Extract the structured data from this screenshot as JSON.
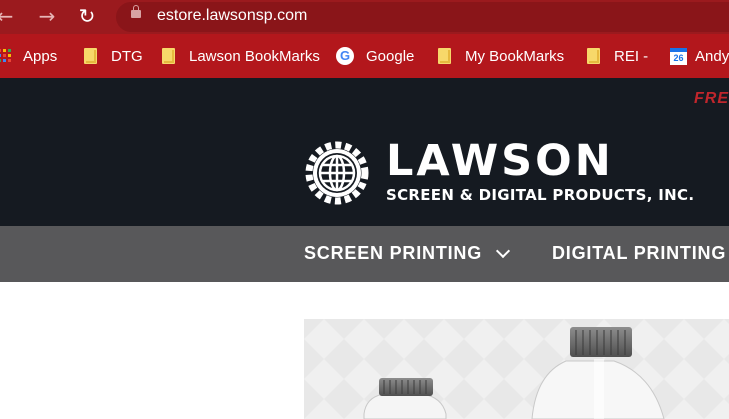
{
  "browser": {
    "back_icon": "arrow-left-icon",
    "forward_icon": "arrow-right-icon",
    "reload_icon": "reload-icon",
    "url": "estore.lawsonsp.com",
    "colors": {
      "toolbar": "#9b1a1e",
      "bookmarks_bar": "#b3171c"
    }
  },
  "bookmarks": [
    {
      "label": "Apps",
      "icon": "apps-grid-icon"
    },
    {
      "label": "DTG",
      "icon": "folder-icon"
    },
    {
      "label": "Lawson BookMarks",
      "icon": "folder-icon"
    },
    {
      "label": "Google",
      "icon": "google-icon"
    },
    {
      "label": "My BookMarks",
      "icon": "folder-icon"
    },
    {
      "label": "REI -",
      "icon": "folder-icon"
    },
    {
      "label": "Andy",
      "icon": "calendar-icon",
      "calendar_day": "26"
    }
  ],
  "site": {
    "promo_text": "FRE",
    "logo": {
      "word": "LAWSON",
      "subtitle": "SCREEN & DIGITAL PRODUCTS, INC."
    },
    "nav": [
      {
        "label": "SCREEN PRINTING",
        "has_dropdown": true
      },
      {
        "label": "DIGITAL PRINTING",
        "has_dropdown": false
      }
    ],
    "colors": {
      "header": "#151a21",
      "nav": "#58585a",
      "accent": "#c0262c"
    }
  }
}
